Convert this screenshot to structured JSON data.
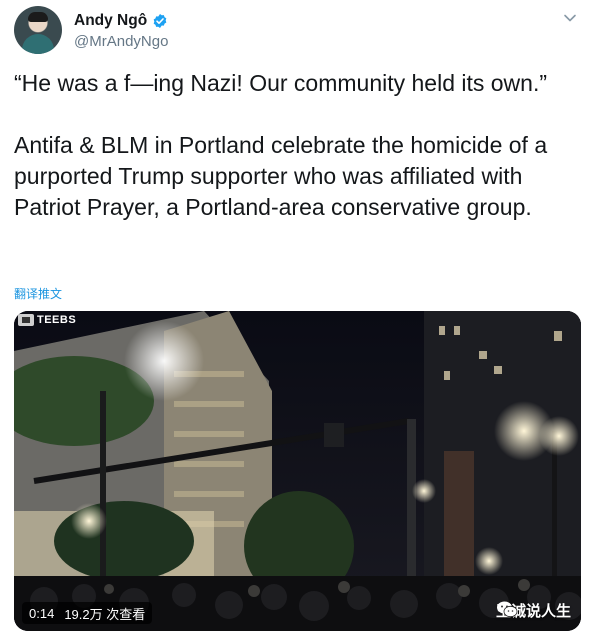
{
  "tweet": {
    "author_name": "Andy Ngô",
    "author_handle": "@MrAndyNgo",
    "text": "“He was a f—ing Nazi! Our community held its own.”\n\nAntifa & BLM in Portland celebrate the homicide of a purported Trump supporter who was affiliated with Patriot Prayer, a Portland-area conservative group.",
    "translate_label": "翻译推文"
  },
  "media": {
    "brand_tag": "TEEBS",
    "duration": "0:14",
    "views": "19.2万 次查看",
    "watermark": "王诚说人生"
  },
  "colors": {
    "verified": "#1da1f2",
    "link": "#1b95e0",
    "text": "#14171a",
    "secondary": "#657786"
  },
  "icons": {
    "verified": "verified-badge-icon",
    "menu": "chevron-down-icon",
    "watermark": "wechat-icon"
  }
}
